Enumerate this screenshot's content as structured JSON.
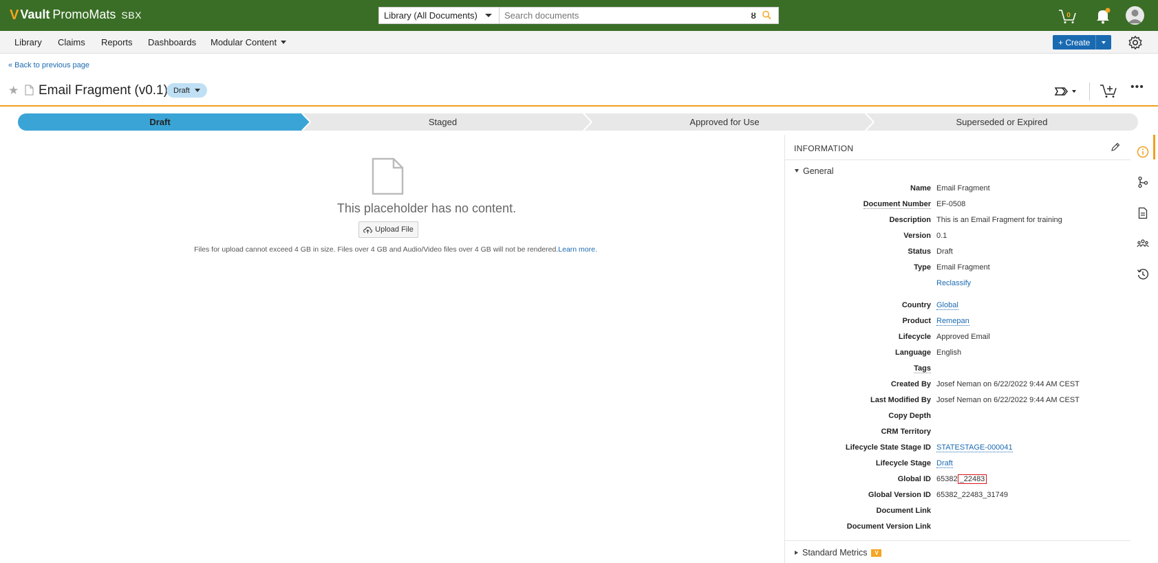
{
  "topbar": {
    "logo_vault": "Vault",
    "logo_app": "PromoMats",
    "logo_env": "SBX",
    "search_scope": "Library (All Documents)",
    "search_placeholder": "Search documents",
    "cart_count": "0"
  },
  "nav": {
    "items": [
      "Library",
      "Claims",
      "Reports",
      "Dashboards",
      "Modular Content"
    ],
    "create_label": "+ Create"
  },
  "back_link": "« Back to previous page",
  "document": {
    "title": "Email Fragment (v0.1)",
    "status_pill": "Draft"
  },
  "lifecycle": {
    "stages": [
      "Draft",
      "Staged",
      "Approved for Use",
      "Superseded or Expired"
    ],
    "active_index": 0
  },
  "viewer": {
    "empty_message": "This placeholder has no content.",
    "upload_button": "Upload File",
    "upload_note": "Files for upload cannot exceed 4 GB in size. Files over 4 GB and Audio/Video files over 4 GB will not be rendered.",
    "learn_more": "Learn more."
  },
  "panel": {
    "header": "INFORMATION",
    "section_general": "General",
    "fields": {
      "name": {
        "label": "Name",
        "value": "Email Fragment"
      },
      "doc_number": {
        "label": "Document Number",
        "value": "EF-0508"
      },
      "description": {
        "label": "Description",
        "value": "This is an Email Fragment for training"
      },
      "version": {
        "label": "Version",
        "value": "0.1"
      },
      "status": {
        "label": "Status",
        "value": "Draft"
      },
      "type": {
        "label": "Type",
        "value": "Email Fragment"
      },
      "reclassify": "Reclassify",
      "country": {
        "label": "Country",
        "value": "Global"
      },
      "product": {
        "label": "Product",
        "value": "Remepan"
      },
      "lifecycle": {
        "label": "Lifecycle",
        "value": "Approved Email"
      },
      "language": {
        "label": "Language",
        "value": "English"
      },
      "tags": {
        "label": "Tags",
        "value": ""
      },
      "created_by": {
        "label": "Created By",
        "value": "Josef Neman on 6/22/2022 9:44 AM CEST"
      },
      "last_modified_by": {
        "label": "Last Modified By",
        "value": "Josef Neman on 6/22/2022 9:44 AM CEST"
      },
      "copy_depth": {
        "label": "Copy Depth",
        "value": ""
      },
      "crm_territory": {
        "label": "CRM Territory",
        "value": ""
      },
      "lifecycle_state_stage_id": {
        "label": "Lifecycle State Stage ID",
        "value": "STATESTAGE-000041"
      },
      "lifecycle_stage": {
        "label": "Lifecycle Stage",
        "value": "Draft"
      },
      "global_id": {
        "label": "Global ID",
        "prefix": "65382",
        "suffix": "_22483"
      },
      "global_version_id": {
        "label": "Global Version ID",
        "value": "65382_22483_31749"
      },
      "document_link": {
        "label": "Document Link",
        "value": ""
      },
      "document_version_link": {
        "label": "Document Version Link",
        "value": ""
      }
    },
    "section_metrics": "Standard Metrics"
  },
  "colors": {
    "topbar": "#3a6e26",
    "accent_orange": "#f0a020",
    "active_stage": "#3ba4d6",
    "link": "#1a6ab1",
    "highlight_box": "#d9131b"
  }
}
